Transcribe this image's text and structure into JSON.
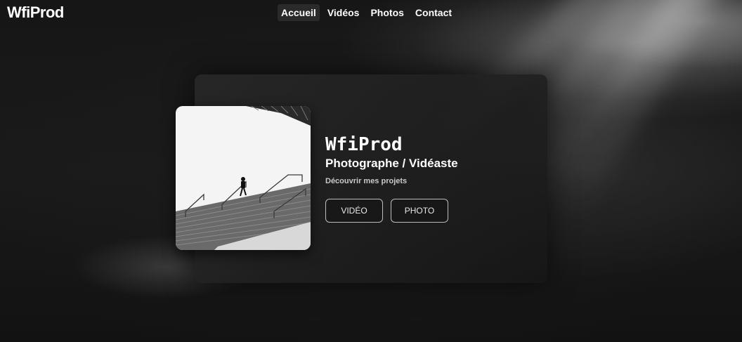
{
  "header": {
    "logo": "WfiProd",
    "nav": [
      "Accueil",
      "Vidéos",
      "Photos",
      "Contact"
    ],
    "active_nav": "Accueil"
  },
  "hero": {
    "title": "WfiProd",
    "subtitle": "Photographe / Vidéaste",
    "tagline": "Découvrir mes projets",
    "buttons": {
      "video": "VIDÉO",
      "photo": "PHOTO"
    },
    "image": "black-and-white photo of a person walking up concrete stairs"
  },
  "colors": {
    "background": "#141414",
    "text": "#ffffff",
    "muted_text": "#c9c9c9",
    "button_border": "#bdbdbd"
  }
}
